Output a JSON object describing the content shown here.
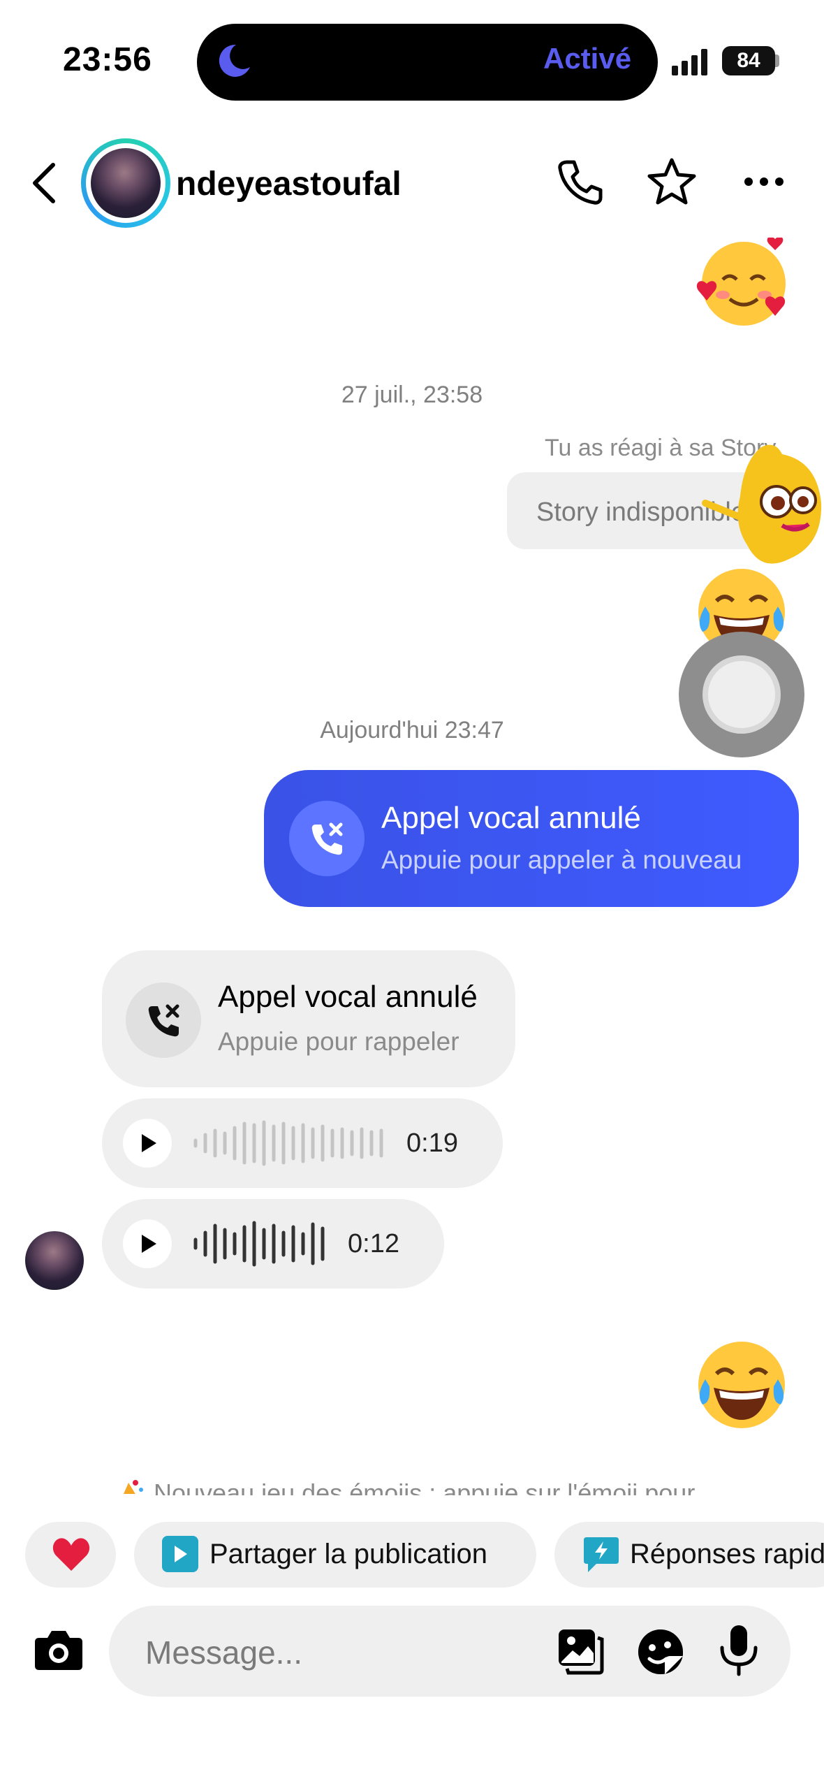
{
  "status_bar": {
    "time": "23:56",
    "focus_mode_label": "Activé",
    "battery_level": "84",
    "focus_color": "#5a5cf0"
  },
  "header": {
    "username": "ndeyeastoufal",
    "icons": [
      "back-chevron-icon",
      "phone-icon",
      "star-icon",
      "more-icon"
    ]
  },
  "thread": {
    "timestamp_1": "27 juil., 23:58",
    "reaction_note": "Tu as réagi à sa Story",
    "story_bubble": "Story indisponible",
    "timestamp_2": "Aujourd'hui 23:47",
    "outgoing_call": {
      "title": "Appel vocal annulé",
      "subtitle": "Appuie pour appeler à nouveau"
    },
    "incoming_call": {
      "title": "Appel vocal annulé",
      "subtitle": "Appuie pour rappeler"
    },
    "voice_messages": [
      {
        "duration": "0:19"
      },
      {
        "duration": "0:12"
      }
    ],
    "emoji_hint": "Nouveau jeu des émojis : appuie sur l'émoji pour"
  },
  "quick_replies": {
    "heart": "❤",
    "share": "Partager la publication",
    "replies": "Réponses rapides"
  },
  "composer": {
    "placeholder": "Message..."
  },
  "colors": {
    "accent_blue": "#3f5bff",
    "bubble_grey": "#efefef"
  }
}
